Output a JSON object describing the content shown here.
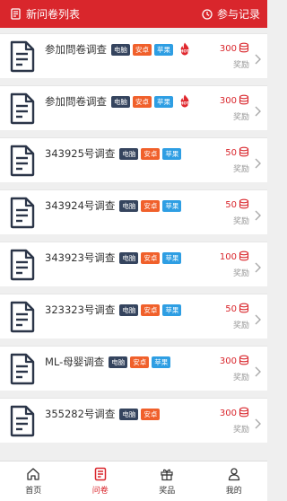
{
  "header": {
    "title": "新问卷列表",
    "record_label": "参与记录"
  },
  "surveys": [
    {
      "title": "参加問卷调查",
      "tags": [
        "电脑",
        "安卓",
        "苹果"
      ],
      "hot": true,
      "reward": "300",
      "reward_label": "奖励"
    },
    {
      "title": "参加問卷调查",
      "tags": [
        "电脑",
        "安卓",
        "苹果"
      ],
      "hot": true,
      "reward": "300",
      "reward_label": "奖励"
    },
    {
      "title": "343925号调查",
      "tags": [
        "电脑",
        "安卓",
        "苹果"
      ],
      "hot": false,
      "reward": "50",
      "reward_label": "奖励"
    },
    {
      "title": "343924号调查",
      "tags": [
        "电脑",
        "安卓",
        "苹果"
      ],
      "hot": false,
      "reward": "50",
      "reward_label": "奖励"
    },
    {
      "title": "343923号调查",
      "tags": [
        "电脑",
        "安卓",
        "苹果"
      ],
      "hot": false,
      "reward": "100",
      "reward_label": "奖励"
    },
    {
      "title": "323323号调查",
      "tags": [
        "电脑",
        "安卓",
        "苹果"
      ],
      "hot": false,
      "reward": "50",
      "reward_label": "奖励"
    },
    {
      "title": "ML-母婴调查",
      "tags": [
        "电脑",
        "安卓",
        "苹果"
      ],
      "hot": false,
      "reward": "300",
      "reward_label": "奖励"
    },
    {
      "title": "355282号调查",
      "tags": [
        "电脑",
        "安卓"
      ],
      "hot": false,
      "reward": "300",
      "reward_label": "奖励"
    }
  ],
  "tabbar": {
    "items": [
      {
        "label": "首页",
        "icon": "home-icon",
        "active": false
      },
      {
        "label": "问卷",
        "icon": "survey-icon",
        "active": true
      },
      {
        "label": "奖品",
        "icon": "gift-icon",
        "active": false
      },
      {
        "label": "我的",
        "icon": "user-icon",
        "active": false
      }
    ]
  },
  "colors": {
    "brand": "#d9262c",
    "tag_pc": "#35445e",
    "tag_android": "#f0602b",
    "tag_apple": "#2e9ee3"
  }
}
